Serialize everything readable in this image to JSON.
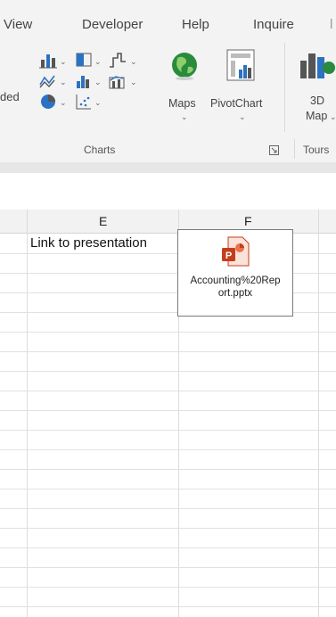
{
  "ribbon": {
    "tabs": [
      "View",
      "Developer",
      "Help",
      "Inquire"
    ],
    "left_cutoff_label": "ded",
    "maps_label": "Maps",
    "pivotchart_label": "PivotChart",
    "map3d_label_line1": "3D",
    "map3d_label_line2": "Map",
    "groups": {
      "charts": "Charts",
      "tours": "Tours"
    }
  },
  "sheet": {
    "column_headers": [
      "E",
      "F"
    ],
    "cell_e1": "Link to presentation",
    "embedded_object": {
      "icon": "powerpoint-file-icon",
      "filename": "Accounting%20Report.pptx",
      "filename_line1": "Accounting%20Rep",
      "filename_line2": "ort.pptx"
    }
  },
  "colors": {
    "ribbon_bg": "#f3f3f3",
    "powerpoint": "#c43e1c",
    "grid": "#e1e1e1",
    "header_bg": "#f2f2f2"
  }
}
